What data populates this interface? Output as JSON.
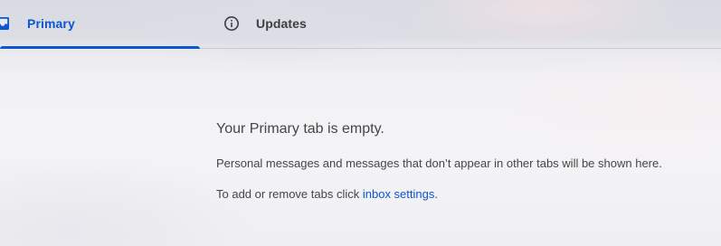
{
  "tabs": [
    {
      "label": "Primary",
      "icon": "inbox-icon",
      "selected": true
    },
    {
      "label": "Updates",
      "icon": "info-icon",
      "selected": false
    }
  ],
  "empty_state": {
    "title": "Your Primary tab is empty.",
    "description": "Personal messages and messages that don’t appear in other tabs will be shown here.",
    "settings_prefix": "To add or remove tabs click ",
    "settings_link": "inbox settings",
    "settings_suffix": "."
  },
  "colors": {
    "accent": "#0b57d0",
    "text": "#444746",
    "tab_text": "#3c4043"
  }
}
